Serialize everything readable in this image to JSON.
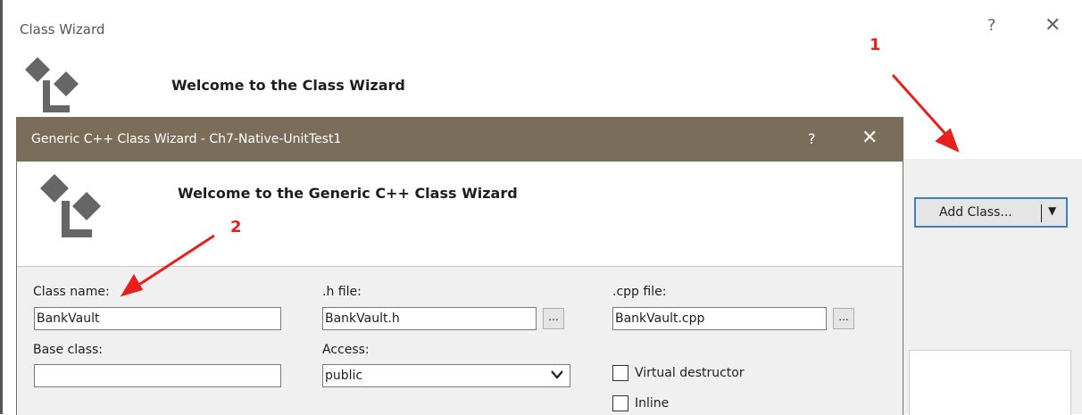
{
  "background_window": {
    "title": "Class Wizard",
    "help": "?",
    "close": "✕",
    "welcome": "Welcome to the Class Wizard",
    "add_class_button": "Add Class..."
  },
  "dialog": {
    "title": "Generic C++ Class Wizard - Ch7-Native-UnitTest1",
    "help": "?",
    "close": "✕",
    "welcome": "Welcome to the Generic C++ Class Wizard"
  },
  "form": {
    "class_name_label": "Class name:",
    "class_name_value": "BankVault",
    "h_file_label": ".h file:",
    "h_file_value": "BankVault.h",
    "cpp_file_label": ".cpp file:",
    "cpp_file_value": "BankVault.cpp",
    "browse": "...",
    "base_class_label": "Base class:",
    "base_class_value": "",
    "access_label": "Access:",
    "access_value": "public",
    "virtual_destructor_label": "Virtual destructor",
    "inline_label": "Inline"
  },
  "annotations": {
    "marker_1": "1",
    "marker_2": "2",
    "arrow_color": "#e8201c"
  }
}
